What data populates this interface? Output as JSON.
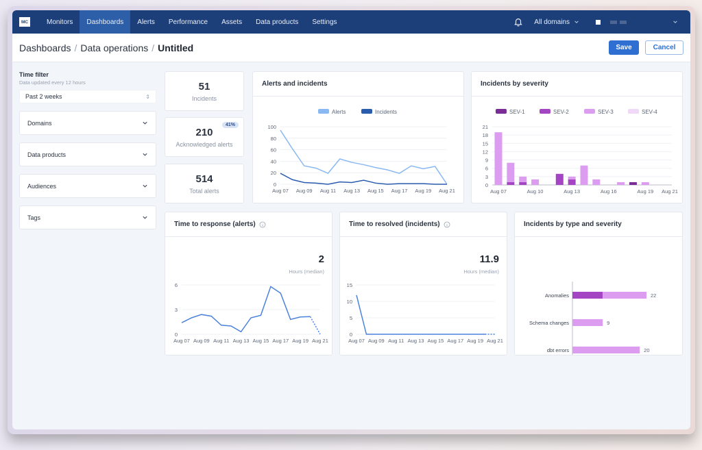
{
  "nav": {
    "logo": "MC",
    "items": [
      {
        "label": "Monitors",
        "active": false
      },
      {
        "label": "Dashboards",
        "active": true
      },
      {
        "label": "Alerts",
        "active": false
      },
      {
        "label": "Performance",
        "active": false
      },
      {
        "label": "Assets",
        "active": false
      },
      {
        "label": "Data products",
        "active": false
      },
      {
        "label": "Settings",
        "active": false
      }
    ],
    "domain_selector": "All domains"
  },
  "header": {
    "breadcrumb": [
      "Dashboards",
      "Data operations",
      "Untitled"
    ],
    "save_label": "Save",
    "cancel_label": "Cancel"
  },
  "sidebar": {
    "time_filter_title": "Time filter",
    "time_filter_sub": "Data updated every 12 hours",
    "time_filter_value": "Past 2 weeks",
    "filters": [
      "Domains",
      "Data products",
      "Audiences",
      "Tags"
    ]
  },
  "stats": {
    "incidents": {
      "value": "51",
      "label": "Incidents"
    },
    "acknowledged": {
      "value": "210",
      "label": "Acknowledged alerts",
      "badge": "41%"
    },
    "total": {
      "value": "514",
      "label": "Total alerts"
    }
  },
  "colors": {
    "alerts": "#8ab8f2",
    "incidents": "#2a5cae",
    "sev1": "#7a2d94",
    "sev2": "#a445c4",
    "sev3": "#dc9df0",
    "sev4": "#f0d9f6",
    "line": "#4a82dc"
  },
  "chart_data": [
    {
      "id": "alerts_incidents",
      "type": "line",
      "title": "Alerts and incidents",
      "x": [
        "Aug 07",
        "Aug 08",
        "Aug 09",
        "Aug 10",
        "Aug 11",
        "Aug 12",
        "Aug 13",
        "Aug 14",
        "Aug 15",
        "Aug 16",
        "Aug 17",
        "Aug 18",
        "Aug 19",
        "Aug 20",
        "Aug 21"
      ],
      "x_ticks": [
        "Aug 07",
        "Aug 09",
        "Aug 11",
        "Aug 13",
        "Aug 15",
        "Aug 17",
        "Aug 19",
        "Aug 21"
      ],
      "series": [
        {
          "name": "Alerts",
          "values": [
            94,
            62,
            32,
            28,
            19,
            44,
            38,
            34,
            29,
            25,
            19,
            32,
            27,
            31,
            0
          ]
        },
        {
          "name": "Incidents",
          "values": [
            19,
            8,
            3,
            2,
            0,
            4,
            3,
            7,
            2,
            0,
            1,
            1,
            1,
            0,
            0
          ]
        }
      ],
      "ylim": [
        0,
        100
      ],
      "y_ticks": [
        0,
        20,
        40,
        60,
        80,
        100
      ],
      "legend": "top"
    },
    {
      "id": "incidents_by_severity",
      "type": "bar",
      "stacked": true,
      "title": "Incidents by severity",
      "x": [
        "Aug 07",
        "Aug 08",
        "Aug 09",
        "Aug 10",
        "Aug 11",
        "Aug 12",
        "Aug 13",
        "Aug 14",
        "Aug 15",
        "Aug 16",
        "Aug 17",
        "Aug 18",
        "Aug 19",
        "Aug 20",
        "Aug 21"
      ],
      "x_ticks": [
        "Aug 07",
        "Aug 10",
        "Aug 13",
        "Aug 16",
        "Aug 19",
        "Aug 21"
      ],
      "x_tick_index": [
        0,
        3,
        6,
        9,
        12,
        14
      ],
      "series": [
        {
          "name": "SEV-1",
          "values": [
            0,
            0,
            0,
            0,
            0,
            0,
            0,
            0,
            0,
            0,
            0,
            1,
            0,
            0,
            0
          ]
        },
        {
          "name": "SEV-2",
          "values": [
            0,
            1,
            1,
            0,
            0,
            4,
            2,
            0,
            0,
            0,
            0,
            0,
            0,
            0,
            0
          ]
        },
        {
          "name": "SEV-3",
          "values": [
            19,
            7,
            2,
            2,
            0,
            0,
            1,
            7,
            2,
            0,
            1,
            0,
            1,
            0,
            0
          ]
        },
        {
          "name": "SEV-4",
          "values": [
            0,
            0,
            0,
            0,
            0,
            0,
            0,
            0,
            0,
            0,
            0,
            0,
            0,
            0,
            0
          ]
        }
      ],
      "ylim": [
        0,
        21
      ],
      "y_ticks": [
        0,
        3,
        6,
        9,
        12,
        15,
        18,
        21
      ],
      "legend": "top"
    },
    {
      "id": "time_to_response",
      "type": "line",
      "title": "Time to response (alerts)",
      "headline_value": "2",
      "headline_label": "Hours (median)",
      "x": [
        "Aug 07",
        "Aug 08",
        "Aug 09",
        "Aug 10",
        "Aug 11",
        "Aug 12",
        "Aug 13",
        "Aug 14",
        "Aug 15",
        "Aug 16",
        "Aug 17",
        "Aug 18",
        "Aug 19",
        "Aug 20",
        "Aug 21"
      ],
      "x_ticks": [
        "Aug 07",
        "Aug 09",
        "Aug 11",
        "Aug 13",
        "Aug 15",
        "Aug 17",
        "Aug 19",
        "Aug 21"
      ],
      "values": [
        1.4,
        2.0,
        2.4,
        2.2,
        1.1,
        1.0,
        0.3,
        2.0,
        2.3,
        5.8,
        5.0,
        1.8,
        2.1,
        2.15,
        0
      ],
      "dashed_last_segment": true,
      "ylim": [
        0,
        6
      ],
      "y_ticks": [
        0,
        3,
        6
      ]
    },
    {
      "id": "time_to_resolved",
      "type": "line",
      "title": "Time to resolved (incidents)",
      "headline_value": "11.9",
      "headline_label": "Hours (median)",
      "x": [
        "Aug 07",
        "Aug 08",
        "Aug 09",
        "Aug 10",
        "Aug 11",
        "Aug 12",
        "Aug 13",
        "Aug 14",
        "Aug 15",
        "Aug 16",
        "Aug 17",
        "Aug 18",
        "Aug 19",
        "Aug 20",
        "Aug 21"
      ],
      "x_ticks": [
        "Aug 07",
        "Aug 09",
        "Aug 11",
        "Aug 13",
        "Aug 15",
        "Aug 17",
        "Aug 19",
        "Aug 21"
      ],
      "values": [
        11.9,
        0,
        0,
        0,
        0,
        0,
        0,
        0,
        0,
        0,
        0,
        0,
        0,
        0,
        0
      ],
      "dashed_last_segment": true,
      "ylim": [
        0,
        15
      ],
      "y_ticks": [
        0,
        5,
        10,
        15
      ]
    },
    {
      "id": "incidents_by_type",
      "type": "bar",
      "orientation": "horizontal",
      "stacked": true,
      "title": "Incidents by type and severity",
      "categories": [
        "Anomalies",
        "Schema changes",
        "dbt errors"
      ],
      "totals": [
        22,
        9,
        20
      ],
      "series": [
        {
          "name": "SEV-2",
          "values": [
            9,
            0,
            0
          ]
        },
        {
          "name": "SEV-3",
          "values": [
            13,
            9,
            20
          ]
        }
      ],
      "xlim": [
        0,
        22
      ]
    }
  ]
}
